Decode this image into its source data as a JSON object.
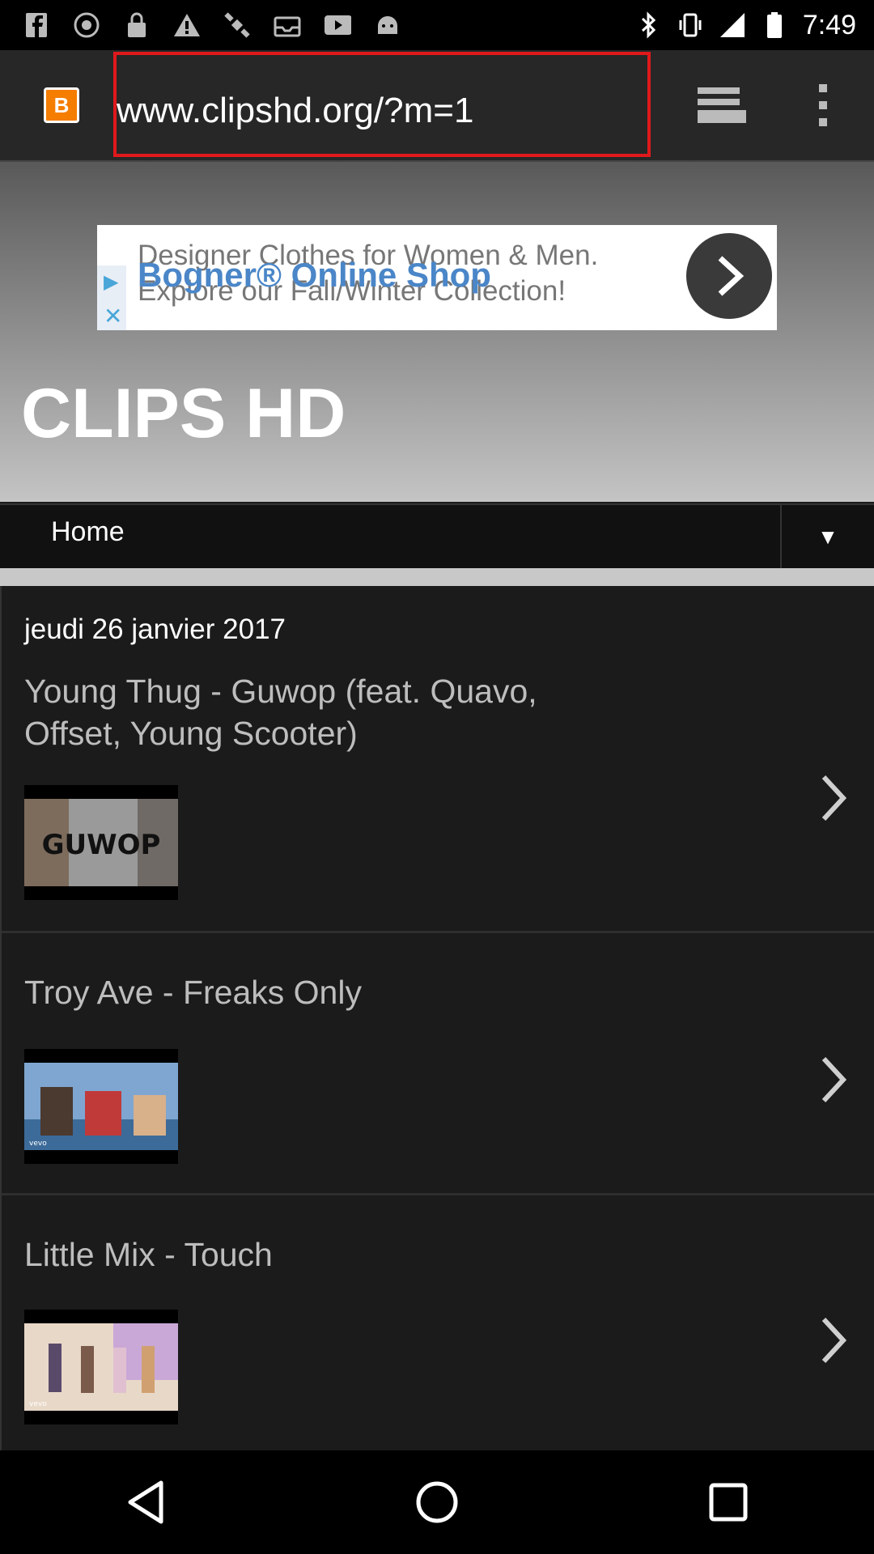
{
  "status_bar": {
    "time": "7:49",
    "left_icons": [
      "facebook-icon",
      "recording-icon",
      "lock-icon",
      "alert-icon",
      "satellite-icon",
      "inbox-icon",
      "youtube-icon",
      "android-icon"
    ],
    "right_icons": [
      "bluetooth-icon",
      "vibrate-icon",
      "signal-icon",
      "battery-icon"
    ]
  },
  "browser": {
    "url": "www.clipshd.org/?m=1",
    "favicon_letter": "B"
  },
  "ad": {
    "line1": "Designer Clothes for Women & Men.",
    "title": "Bogner® Online Shop",
    "line2": "Explore our Fall/Winter Collection!"
  },
  "site": {
    "title": "CLIPS HD",
    "nav_home": "Home",
    "nav_toggle": "▼"
  },
  "content": {
    "date": "jeudi 26 janvier 2017",
    "posts": [
      {
        "title": "Young Thug - Guwop (feat. Quavo, Offset, Young Scooter)",
        "thumb_text": "GUWOP"
      },
      {
        "title": "Troy Ave - Freaks Only",
        "thumb_text": "vevo"
      },
      {
        "title": "Little Mix - Touch",
        "thumb_text": "vevo"
      }
    ]
  },
  "colors": {
    "url_highlight": "#e0191b",
    "toolbar": "#272727",
    "page_bg": "#1b1b1b",
    "blogger_orange": "#f57d00"
  }
}
